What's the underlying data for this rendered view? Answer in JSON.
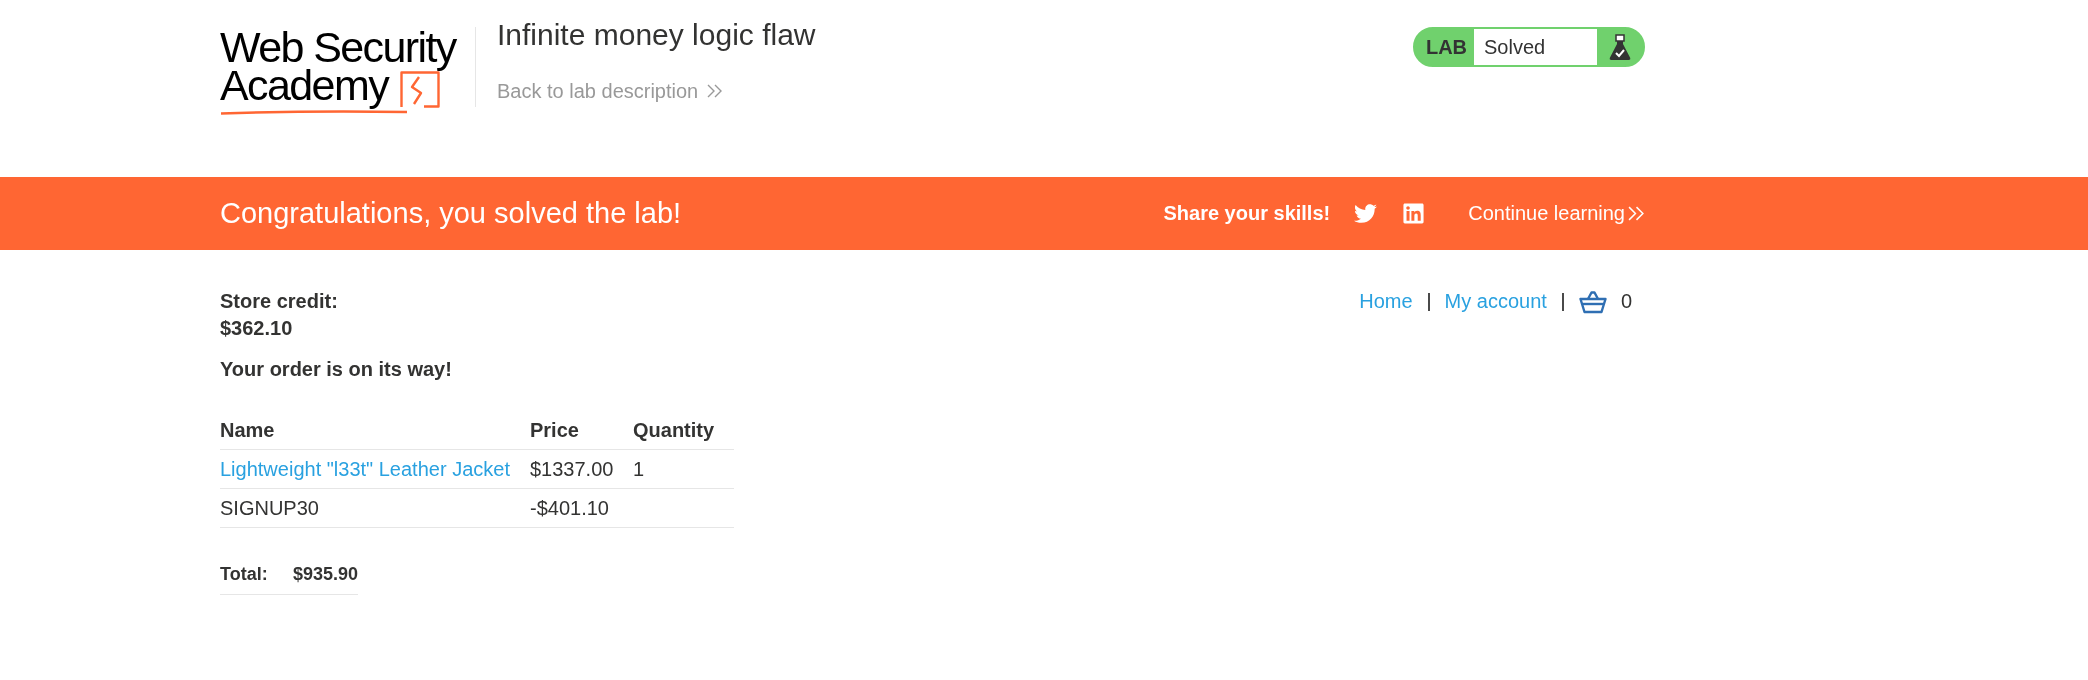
{
  "header": {
    "logo": {
      "line_1": "Web Security",
      "line_2": "Academy"
    },
    "title": "Infinite money logic flaw",
    "back_link": "Back to lab description"
  },
  "lab_status": {
    "label": "LAB",
    "status": "Solved",
    "solved": true
  },
  "banner": {
    "message": "Congratulations, you solved the lab!",
    "share_label": "Share your skills!",
    "continue_link": "Continue learning"
  },
  "nav": {
    "links": [
      {
        "label": "Home"
      },
      {
        "label": "My account"
      }
    ],
    "cart_count": "0"
  },
  "store_credit": {
    "label": "Store credit:",
    "amount": "$362.10"
  },
  "order_message": "Your order is on its way!",
  "table": {
    "columns": [
      "Name",
      "Price",
      "Quantity"
    ],
    "rows": [
      {
        "kind": "product",
        "name": "Lightweight \"l33t\" Leather Jacket",
        "price": "$1337.00",
        "quantity": "1"
      },
      {
        "kind": "coupon",
        "name": "SIGNUP30",
        "price": "-$401.10"
      }
    ]
  },
  "total": {
    "label": "Total:",
    "amount": "$935.90"
  }
}
